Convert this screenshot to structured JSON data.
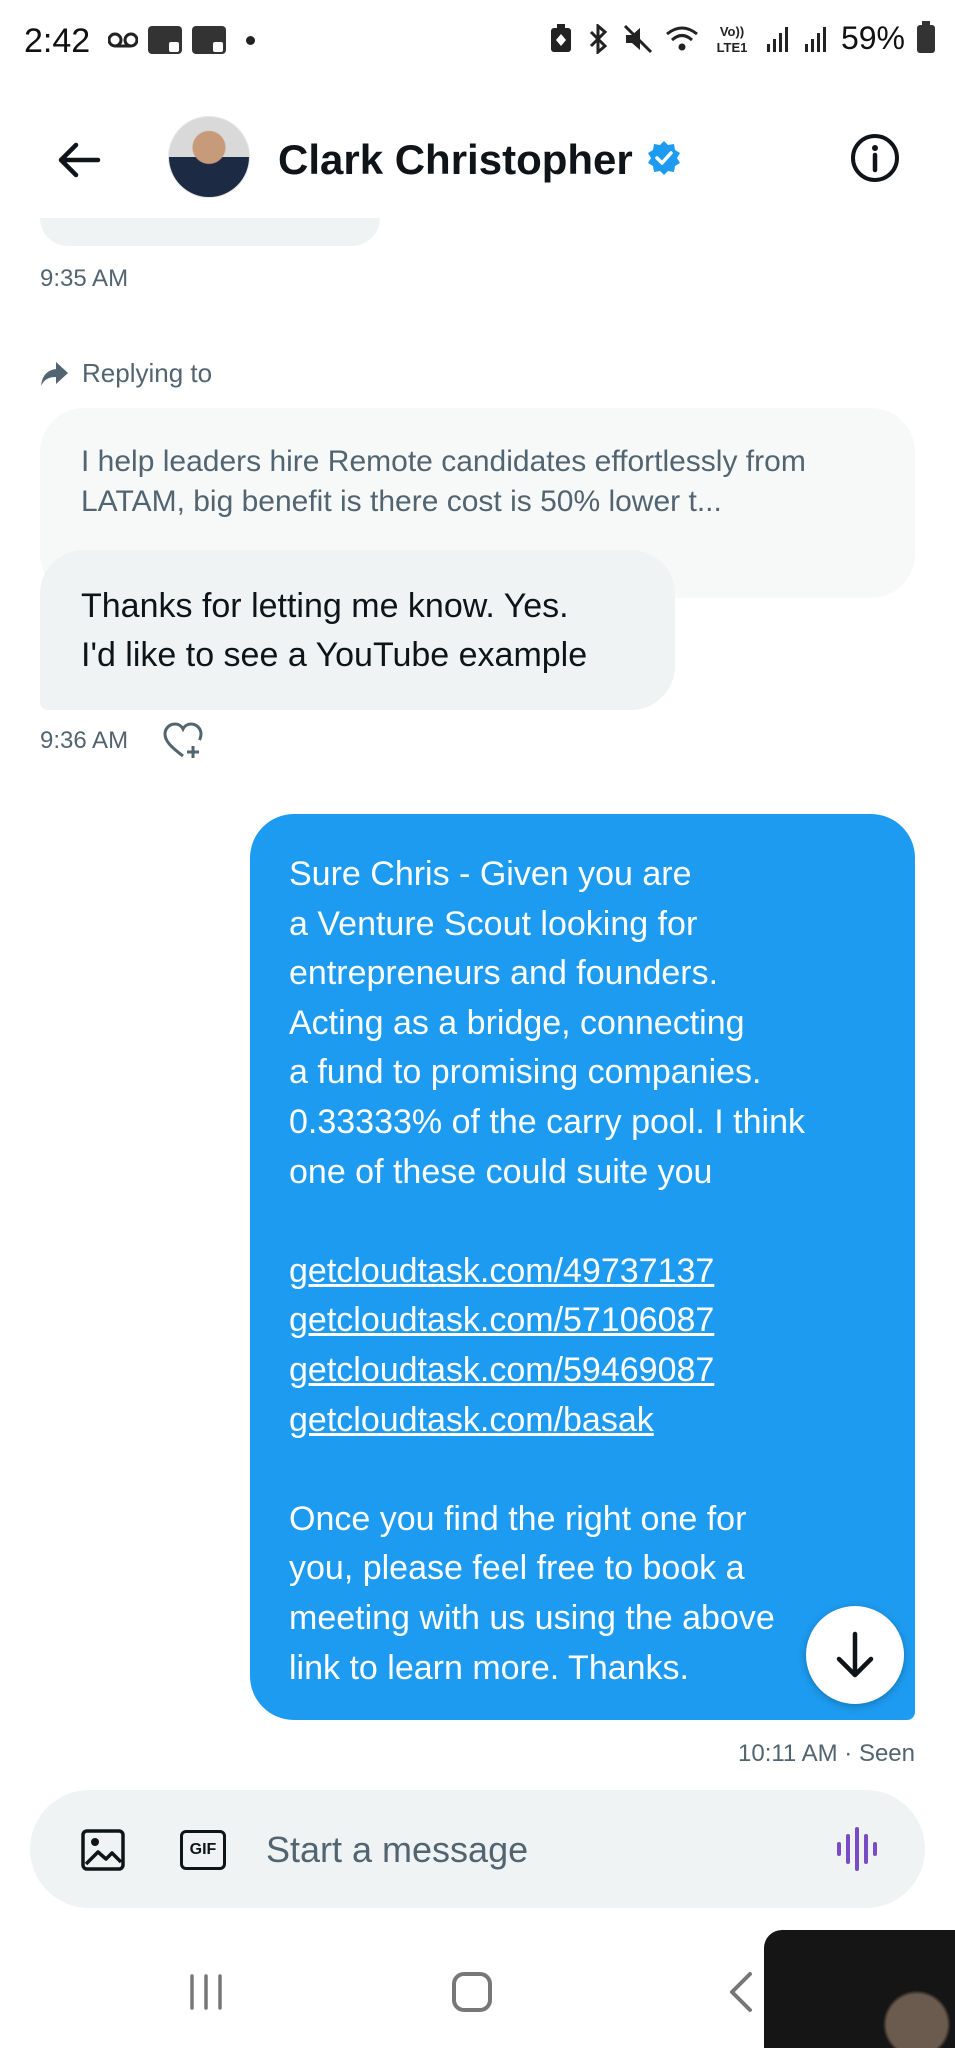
{
  "status_bar": {
    "time": "2:42",
    "battery": "59%",
    "icons": [
      "voicemail-icon",
      "sim1-icon",
      "sim2-icon",
      "notification-dot-icon",
      "battery-saver-icon",
      "bluetooth-icon",
      "mute-icon",
      "wifi-icon",
      "volte-icon",
      "signal-icon",
      "signal-icon",
      "battery-icon"
    ]
  },
  "header": {
    "contact_name": "Clark Christopher",
    "verified": true,
    "icons": [
      "back-arrow-icon",
      "avatar",
      "verified-badge-icon",
      "info-icon"
    ]
  },
  "messages": {
    "ts_first": "9:35 AM",
    "replying_label": "Replying to",
    "quoted_text": "I help leaders hire Remote candidates effortlessly from LATAM, big benefit is there cost is 50% lower t...",
    "incoming": {
      "line1": "Thanks for letting me know. Yes.",
      "line2": "I'd like to see a YouTube example"
    },
    "ts_second": "9:36 AM",
    "outgoing": {
      "lines": [
        "Sure Chris - Given you are",
        "a Venture Scout looking for",
        "entrepreneurs and founders.",
        "Acting as a bridge, connecting",
        "a fund to promising companies.",
        "0.33333% of the carry pool. I think",
        "one of these could suite you"
      ],
      "links": [
        "getcloudtask.com/49737137",
        "getcloudtask.com/57106087",
        "getcloudtask.com/59469087",
        "getcloudtask.com/basak"
      ],
      "closing": [
        "Once you find the right one for",
        "you, please feel free to book a",
        "meeting with us using the above",
        "link to learn more. Thanks."
      ]
    },
    "ts_outgoing": "10:11 AM · Seen"
  },
  "composer": {
    "placeholder": "Start a message",
    "gif_label": "GIF",
    "accent": "#794bc4"
  },
  "colors": {
    "outgoing_bubble": "#1d9bf0",
    "incoming_bubble": "#eff3f4",
    "secondary_text": "#536471",
    "verified": "#1d9bf0"
  }
}
